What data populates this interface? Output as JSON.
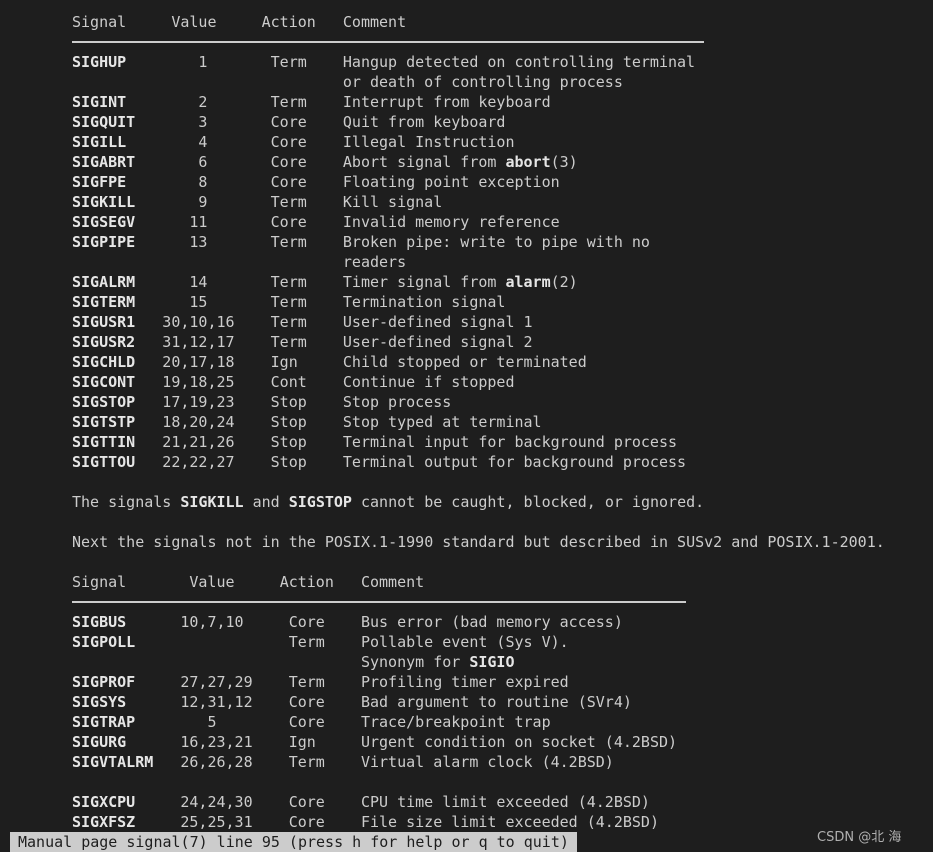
{
  "table1": {
    "headers": [
      "Signal",
      "Value",
      "Action",
      "Comment"
    ],
    "rows": [
      {
        "signal": "SIGHUP",
        "value": "1",
        "action": "Term",
        "comment": [
          [
            {
              "t": "Hangup detected on controlling terminal"
            }
          ],
          [
            {
              "t": "or death of controlling process"
            }
          ]
        ]
      },
      {
        "signal": "SIGINT",
        "value": "2",
        "action": "Term",
        "comment": [
          [
            {
              "t": "Interrupt from keyboard"
            }
          ]
        ]
      },
      {
        "signal": "SIGQUIT",
        "value": "3",
        "action": "Core",
        "comment": [
          [
            {
              "t": "Quit from keyboard"
            }
          ]
        ]
      },
      {
        "signal": "SIGILL",
        "value": "4",
        "action": "Core",
        "comment": [
          [
            {
              "t": "Illegal Instruction"
            }
          ]
        ]
      },
      {
        "signal": "SIGABRT",
        "value": "6",
        "action": "Core",
        "comment": [
          [
            {
              "t": "Abort signal from "
            },
            {
              "t": "abort",
              "b": true
            },
            {
              "t": "(3)"
            }
          ]
        ]
      },
      {
        "signal": "SIGFPE",
        "value": "8",
        "action": "Core",
        "comment": [
          [
            {
              "t": "Floating point exception"
            }
          ]
        ]
      },
      {
        "signal": "SIGKILL",
        "value": "9",
        "action": "Term",
        "comment": [
          [
            {
              "t": "Kill signal"
            }
          ]
        ]
      },
      {
        "signal": "SIGSEGV",
        "value": "11",
        "action": "Core",
        "comment": [
          [
            {
              "t": "Invalid memory reference"
            }
          ]
        ]
      },
      {
        "signal": "SIGPIPE",
        "value": "13",
        "action": "Term",
        "comment": [
          [
            {
              "t": "Broken pipe: write to pipe with no"
            }
          ],
          [
            {
              "t": "readers"
            }
          ]
        ]
      },
      {
        "signal": "SIGALRM",
        "value": "14",
        "action": "Term",
        "comment": [
          [
            {
              "t": "Timer signal from "
            },
            {
              "t": "alarm",
              "b": true
            },
            {
              "t": "(2)"
            }
          ]
        ]
      },
      {
        "signal": "SIGTERM",
        "value": "15",
        "action": "Term",
        "comment": [
          [
            {
              "t": "Termination signal"
            }
          ]
        ]
      },
      {
        "signal": "SIGUSR1",
        "value": "30,10,16",
        "action": "Term",
        "comment": [
          [
            {
              "t": "User-defined signal 1"
            }
          ]
        ]
      },
      {
        "signal": "SIGUSR2",
        "value": "31,12,17",
        "action": "Term",
        "comment": [
          [
            {
              "t": "User-defined signal 2"
            }
          ]
        ]
      },
      {
        "signal": "SIGCHLD",
        "value": "20,17,18",
        "action": "Ign",
        "comment": [
          [
            {
              "t": "Child stopped or terminated"
            }
          ]
        ]
      },
      {
        "signal": "SIGCONT",
        "value": "19,18,25",
        "action": "Cont",
        "comment": [
          [
            {
              "t": "Continue if stopped"
            }
          ]
        ]
      },
      {
        "signal": "SIGSTOP",
        "value": "17,19,23",
        "action": "Stop",
        "comment": [
          [
            {
              "t": "Stop process"
            }
          ]
        ]
      },
      {
        "signal": "SIGTSTP",
        "value": "18,20,24",
        "action": "Stop",
        "comment": [
          [
            {
              "t": "Stop typed at terminal"
            }
          ]
        ]
      },
      {
        "signal": "SIGTTIN",
        "value": "21,21,26",
        "action": "Stop",
        "comment": [
          [
            {
              "t": "Terminal input for background process"
            }
          ]
        ]
      },
      {
        "signal": "SIGTTOU",
        "value": "22,22,27",
        "action": "Stop",
        "comment": [
          [
            {
              "t": "Terminal output for background process"
            }
          ]
        ]
      }
    ]
  },
  "para1": [
    {
      "t": "The signals "
    },
    {
      "t": "SIGKILL",
      "b": true
    },
    {
      "t": " and "
    },
    {
      "t": "SIGSTOP",
      "b": true
    },
    {
      "t": " cannot be caught, blocked, or ignored."
    }
  ],
  "para2": [
    {
      "t": "Next the signals not in the POSIX.1-1990 standard but described in SUSv2 and POSIX.1-2001."
    }
  ],
  "table2": {
    "headers": [
      "Signal",
      "Value",
      "Action",
      "Comment"
    ],
    "rows": [
      {
        "signal": "SIGBUS",
        "value": "10,7,10",
        "action": "Core",
        "comment": [
          [
            {
              "t": "Bus error (bad memory access)"
            }
          ]
        ]
      },
      {
        "signal": "SIGPOLL",
        "value": "",
        "action": "Term",
        "comment": [
          [
            {
              "t": "Pollable event (Sys V)."
            }
          ],
          [
            {
              "t": "Synonym for "
            },
            {
              "t": "SIGIO",
              "b": true
            }
          ]
        ]
      },
      {
        "signal": "SIGPROF",
        "value": "27,27,29",
        "action": "Term",
        "comment": [
          [
            {
              "t": "Profiling timer expired"
            }
          ]
        ]
      },
      {
        "signal": "SIGSYS",
        "value": "12,31,12",
        "action": "Core",
        "comment": [
          [
            {
              "t": "Bad argument to routine (SVr4)"
            }
          ]
        ]
      },
      {
        "signal": "SIGTRAP",
        "value": "5",
        "action": "Core",
        "comment": [
          [
            {
              "t": "Trace/breakpoint trap"
            }
          ]
        ]
      },
      {
        "signal": "SIGURG",
        "value": "16,23,21",
        "action": "Ign",
        "comment": [
          [
            {
              "t": "Urgent condition on socket (4.2BSD)"
            }
          ]
        ]
      },
      {
        "signal": "SIGVTALRM",
        "value": "26,26,28",
        "action": "Term",
        "comment": [
          [
            {
              "t": "Virtual alarm clock (4.2BSD)"
            }
          ]
        ]
      },
      {
        "blank": true
      },
      {
        "signal": "SIGXCPU",
        "value": "24,24,30",
        "action": "Core",
        "comment": [
          [
            {
              "t": "CPU time limit exceeded (4.2BSD)"
            }
          ]
        ]
      },
      {
        "signal": "SIGXFSZ",
        "value": "25,25,31",
        "action": "Core",
        "comment": [
          [
            {
              "t": "File size limit exceeded (4.2BSD)"
            }
          ]
        ]
      }
    ]
  },
  "status_bar": "Manual page signal(7) line 95 (press h for help or q to quit)",
  "watermark": "CSDN @北  海"
}
